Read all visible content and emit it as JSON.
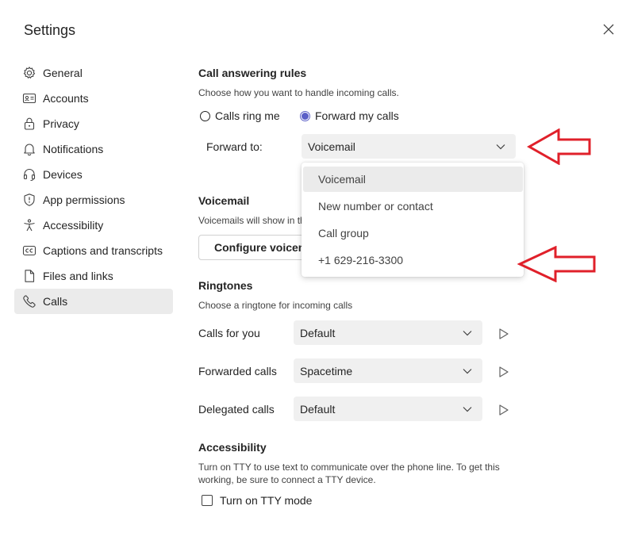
{
  "window": {
    "title": "Settings"
  },
  "sidebar": {
    "items": [
      {
        "label": "General",
        "icon": "gear-icon"
      },
      {
        "label": "Accounts",
        "icon": "id-card-icon"
      },
      {
        "label": "Privacy",
        "icon": "lock-icon"
      },
      {
        "label": "Notifications",
        "icon": "bell-icon"
      },
      {
        "label": "Devices",
        "icon": "headset-icon"
      },
      {
        "label": "App permissions",
        "icon": "shield-icon"
      },
      {
        "label": "Accessibility",
        "icon": "accessibility-icon"
      },
      {
        "label": "Captions and transcripts",
        "icon": "cc-icon"
      },
      {
        "label": "Files and links",
        "icon": "file-icon"
      },
      {
        "label": "Calls",
        "icon": "phone-icon",
        "active": true
      }
    ]
  },
  "call_answering": {
    "heading": "Call answering rules",
    "description": "Choose how you want to handle incoming calls.",
    "option_ring": "Calls ring me",
    "option_forward": "Forward my calls",
    "selected_option": "Forward my calls",
    "forward_label": "Forward to:",
    "forward_value": "Voicemail",
    "dropdown_options": [
      "Voicemail",
      "New number or contact",
      "Call group",
      "+1 629-216-3300"
    ],
    "dropdown_highlighted": "Voicemail"
  },
  "voicemail": {
    "heading": "Voicemail",
    "description": "Voicemails will show in th",
    "configure_button": "Configure voicem"
  },
  "ringtones": {
    "heading": "Ringtones",
    "description": "Choose a ringtone for incoming calls",
    "rows": [
      {
        "label": "Calls for you",
        "value": "Default"
      },
      {
        "label": "Forwarded calls",
        "value": "Spacetime"
      },
      {
        "label": "Delegated calls",
        "value": "Default"
      }
    ]
  },
  "accessibility": {
    "heading": "Accessibility",
    "description_line1": "Turn on TTY to use text to communicate over the phone line. To get this",
    "description_line2": "working, be sure to connect a TTY device.",
    "tty_label": "Turn on TTY mode",
    "tty_checked": false
  },
  "colors": {
    "accent": "#5b5fc7",
    "annotation_arrow": "#e0202a",
    "selected_bg": "#ebebeb",
    "field_bg": "#f0f0f0"
  }
}
